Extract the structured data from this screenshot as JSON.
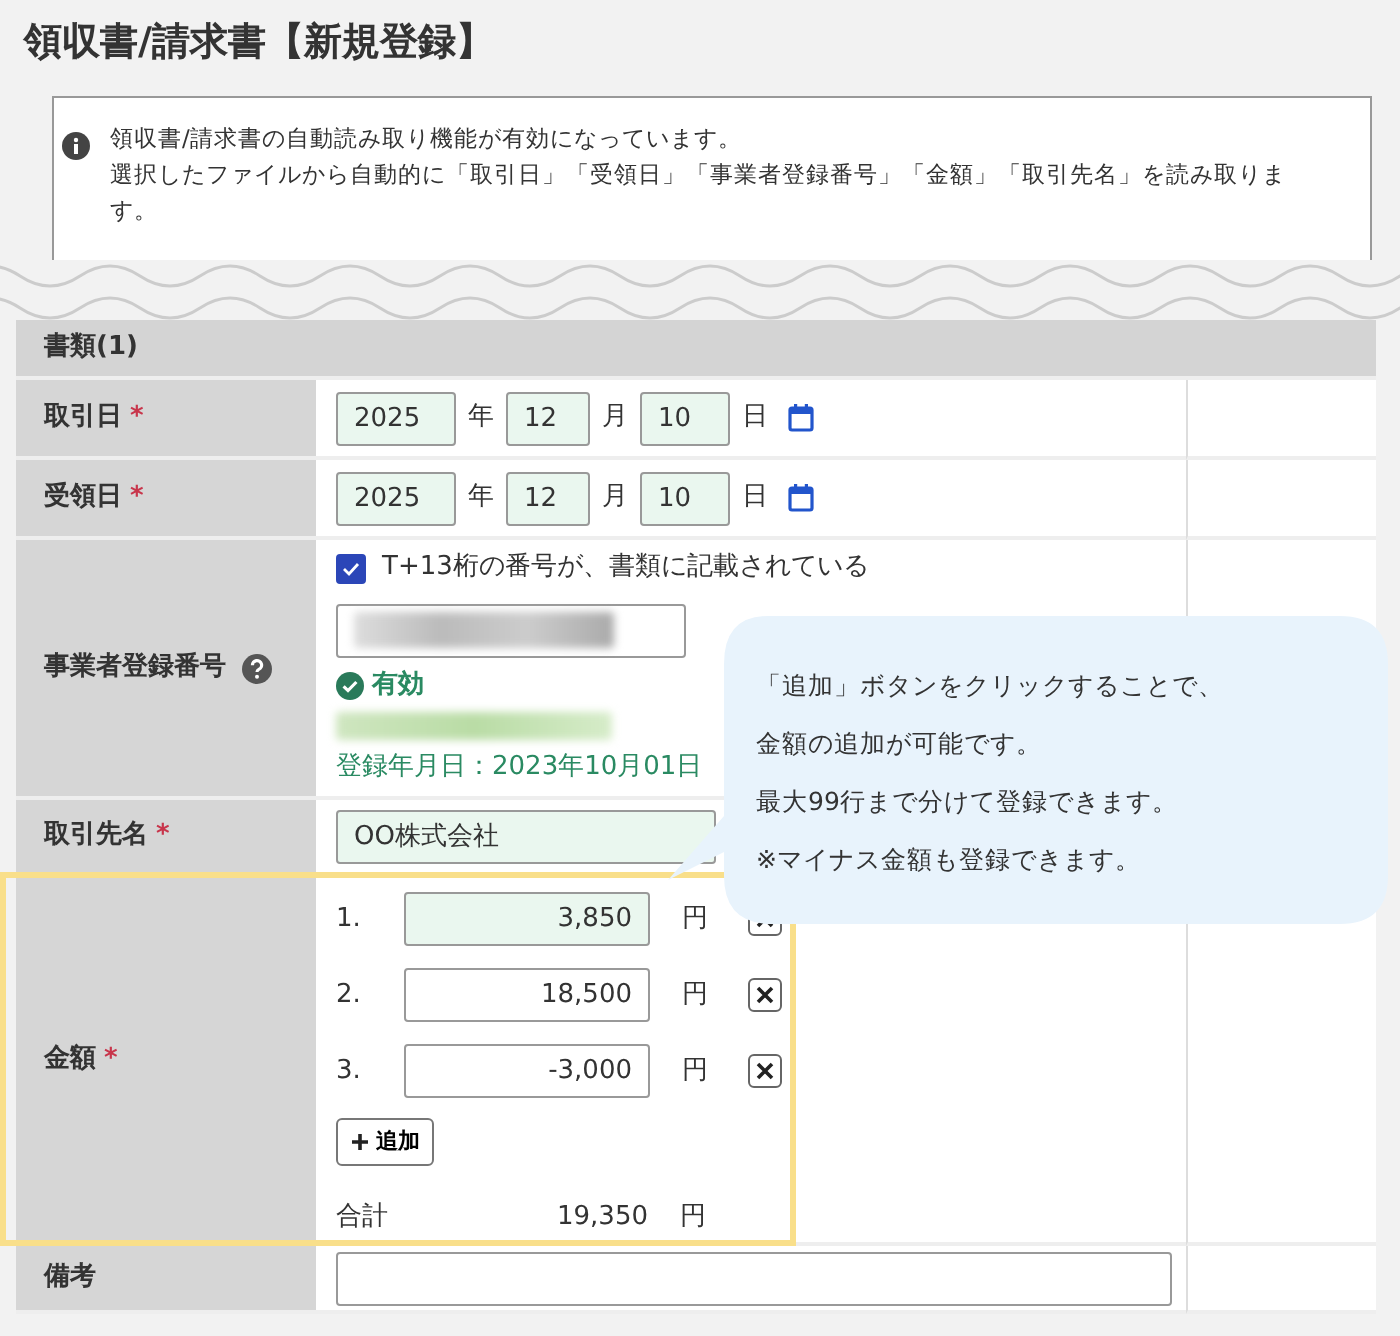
{
  "title": "領収書/請求書【新規登録】",
  "notice": {
    "lines": [
      "領収書/請求書の自動読み取り機能が有効になっています。",
      "選択したファイルから自動的に「取引日」「受領日」「事業者登録番号」「金額」「取引先名」を読み取ります。"
    ]
  },
  "required_mark": "*",
  "section": "書類(1)",
  "rows": [
    {
      "kind": "date",
      "label": "取引日",
      "required": true,
      "year": "2025",
      "year_unit": "年",
      "month": "12",
      "month_unit": "月",
      "day": "10",
      "day_unit": "日",
      "autofilled": true
    },
    {
      "kind": "date",
      "label": "受領日",
      "required": true,
      "year": "2025",
      "year_unit": "年",
      "month": "12",
      "month_unit": "月",
      "day": "10",
      "day_unit": "日",
      "autofilled": true
    },
    {
      "kind": "registration",
      "label": "事業者登録番号",
      "required": false,
      "help": true,
      "checkbox": {
        "label": "T+13桁の番号が、書類に記載されている",
        "checked": true
      },
      "status": "有効",
      "registered": "登録年月日：2023年10月01日"
    },
    {
      "kind": "text",
      "label": "取引先名",
      "required": true,
      "value": "OO株式会社",
      "autofilled": true
    },
    {
      "kind": "amounts",
      "label": "金額",
      "required": true,
      "highlighted": true,
      "items": [
        {
          "number": "1.",
          "value": "3,850",
          "unit": "円",
          "autofilled": true
        },
        {
          "number": "2.",
          "value": "18,500",
          "unit": "円",
          "autofilled": false
        },
        {
          "number": "3.",
          "value": "-3,000",
          "unit": "円",
          "autofilled": false
        }
      ],
      "add_button": "追加",
      "total_label": "合計",
      "total": "19,350",
      "total_unit": "円"
    },
    {
      "kind": "text",
      "label": "備考",
      "required": false,
      "autofilled": false
    }
  ],
  "callout": {
    "lines": [
      "「追加」ボタンをクリックすることで、",
      "金額の追加が可能です。",
      "最大99行まで分けて登録できます。",
      "※マイナス金額も登録できます。"
    ]
  }
}
